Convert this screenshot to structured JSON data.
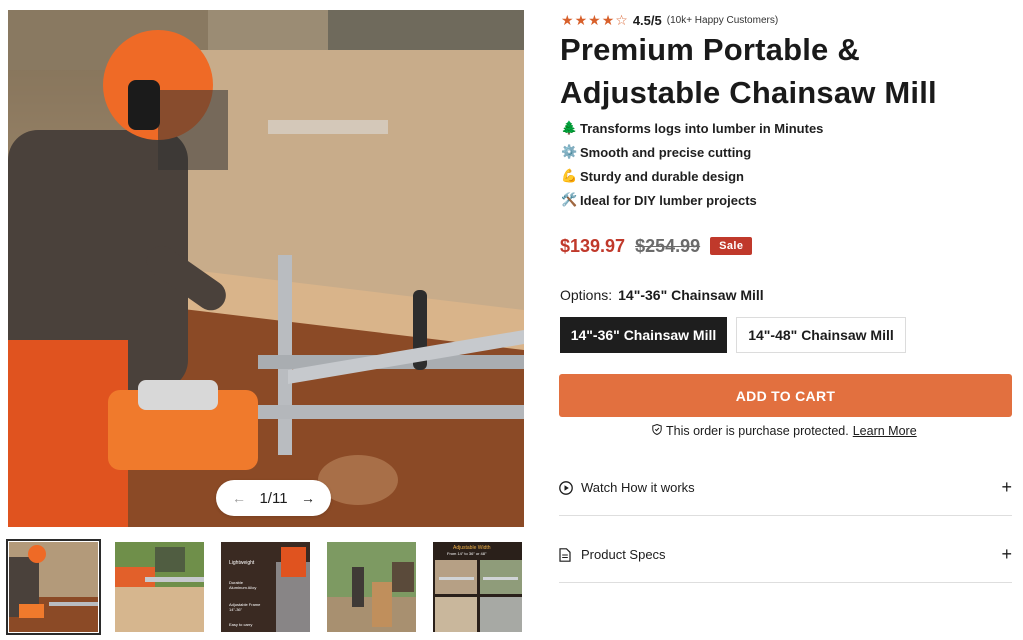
{
  "gallery": {
    "current": "1",
    "total": "11",
    "counter": "1/11",
    "thumbnails": [
      {
        "name": "thumb-1",
        "active": true
      },
      {
        "name": "thumb-2",
        "active": false
      },
      {
        "name": "thumb-3",
        "active": false
      },
      {
        "name": "thumb-4",
        "active": false
      },
      {
        "name": "thumb-5",
        "active": false
      }
    ],
    "thumb3_lines": [
      "Lightweight",
      "Durable Aluminum Alloy",
      "Adjustable Frame 14\"-36\"",
      "Easy to carry"
    ],
    "thumb5_lines": [
      "Adjustable Width",
      "From 14\" to 36\" or 48\""
    ]
  },
  "rating": {
    "stars": 4.5,
    "score": "4.5/5",
    "note": "(10k+ Happy Customers)"
  },
  "product": {
    "title": "Premium Portable & Adjustable Chainsaw Mill",
    "features": [
      {
        "icon": "tree-icon",
        "glyph": "🌲",
        "text": "Transforms logs into lumber in Minutes"
      },
      {
        "icon": "gear-icon",
        "glyph": "⚙️",
        "text": "Smooth and precise cutting"
      },
      {
        "icon": "flexed-arm-icon",
        "glyph": "💪",
        "text": "Sturdy and durable design"
      },
      {
        "icon": "tools-icon",
        "glyph": "🛠️",
        "text": "Ideal for DIY lumber projects"
      }
    ],
    "price": "$139.97",
    "compare_price": "$254.99",
    "sale_badge": "Sale"
  },
  "options": {
    "label": "Options:",
    "selected": "14\"-36\" Chainsaw Mill",
    "variants": [
      "14\"-36\" Chainsaw Mill",
      "14\"-48\" Chainsaw Mill"
    ]
  },
  "cart": {
    "button_label": "ADD TO CART",
    "protect_text": "This order is purchase protected.",
    "learn_more": "Learn More"
  },
  "accordions": [
    {
      "label": "Watch How it works",
      "icon": "play-circle-icon"
    },
    {
      "label": "Product Specs",
      "icon": "document-icon"
    }
  ],
  "colors": {
    "accent": "#e2703f",
    "star": "#d8602b",
    "sale": "#c0392b",
    "selected_variant": "#1e1e1e"
  }
}
